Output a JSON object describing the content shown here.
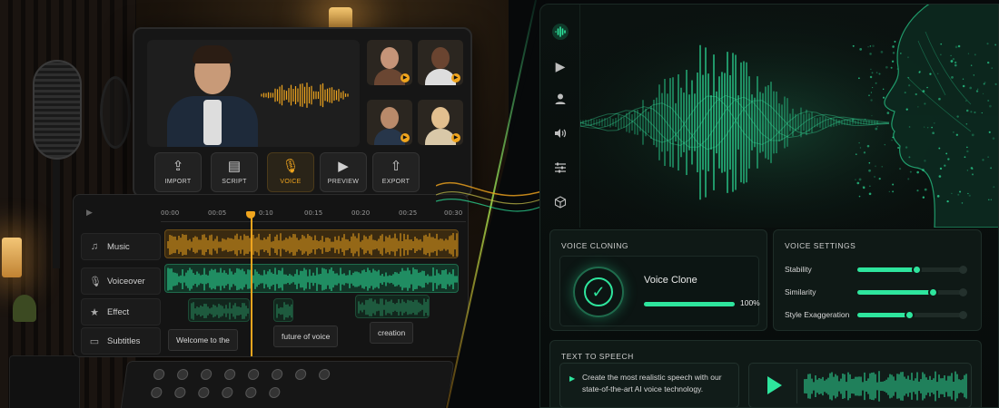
{
  "editor": {
    "toolbar": [
      {
        "label": "IMPORT",
        "icon": "upload-icon",
        "active": false
      },
      {
        "label": "SCRIPT",
        "icon": "document-icon",
        "active": false
      },
      {
        "label": "VOICE",
        "icon": "microphone-icon",
        "active": true
      },
      {
        "label": "PREVIEW",
        "icon": "play-icon",
        "active": false
      },
      {
        "label": "EXPORT",
        "icon": "export-icon",
        "active": false
      }
    ],
    "timeline": {
      "ticks": [
        "00:00",
        "00:05",
        "0:10",
        "00:15",
        "00:20",
        "00:25",
        "00:30"
      ],
      "tracks": [
        {
          "label": "Music",
          "icon": "music-note-icon"
        },
        {
          "label": "Voiceover",
          "icon": "microphone-icon"
        },
        {
          "label": "Effect",
          "icon": "star-icon"
        },
        {
          "label": "Subtitles",
          "icon": "subtitles-icon"
        }
      ],
      "subtitles": [
        "Welcome to the",
        "future of voice",
        "creation"
      ]
    }
  },
  "app": {
    "sidebar_icons": [
      "waveform-logo-icon",
      "play-icon",
      "user-icon",
      "speaker-icon",
      "sliders-icon",
      "cube-icon"
    ],
    "voice_cloning": {
      "title": "VOICE CLONING",
      "clone_label": "Voice Clone",
      "progress_text": "100%",
      "progress": 1.0
    },
    "voice_settings": {
      "title": "VOICE SETTINGS",
      "sliders": [
        {
          "label": "Stability",
          "value": 0.55
        },
        {
          "label": "Similarity",
          "value": 0.7
        },
        {
          "label": "Style Exaggeration",
          "value": 0.48
        }
      ]
    },
    "tts": {
      "title": "TEXT TO SPEECH",
      "text": "Create the most realistic speech with our state-of-the-art AI voice technology."
    }
  },
  "colors": {
    "accent_orange": "#f0a51e",
    "accent_green": "#2ee59d",
    "voiceover_green": "#2a8f5f"
  }
}
